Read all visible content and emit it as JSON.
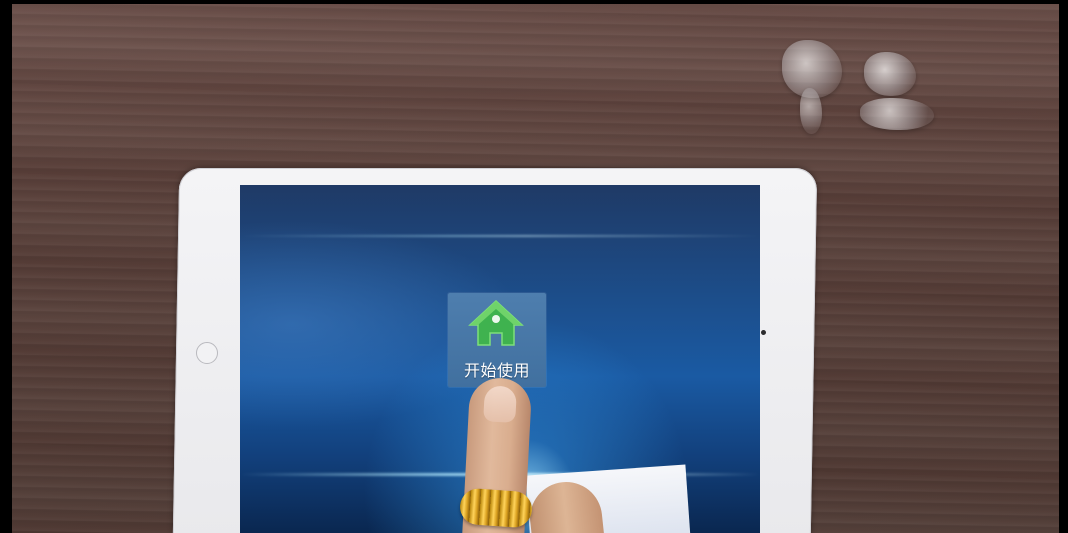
{
  "scene": {
    "description_tag": "photo-of-tablet"
  },
  "app": {
    "label": "开始使用",
    "icon": "home-icon",
    "tile_color": "#4677a6",
    "icon_color": "#4cc05a"
  },
  "colors": {
    "screen_blue": "#1a5aa3",
    "tablet_body": "#f0f0f2",
    "table_wood": "#5e4640"
  }
}
